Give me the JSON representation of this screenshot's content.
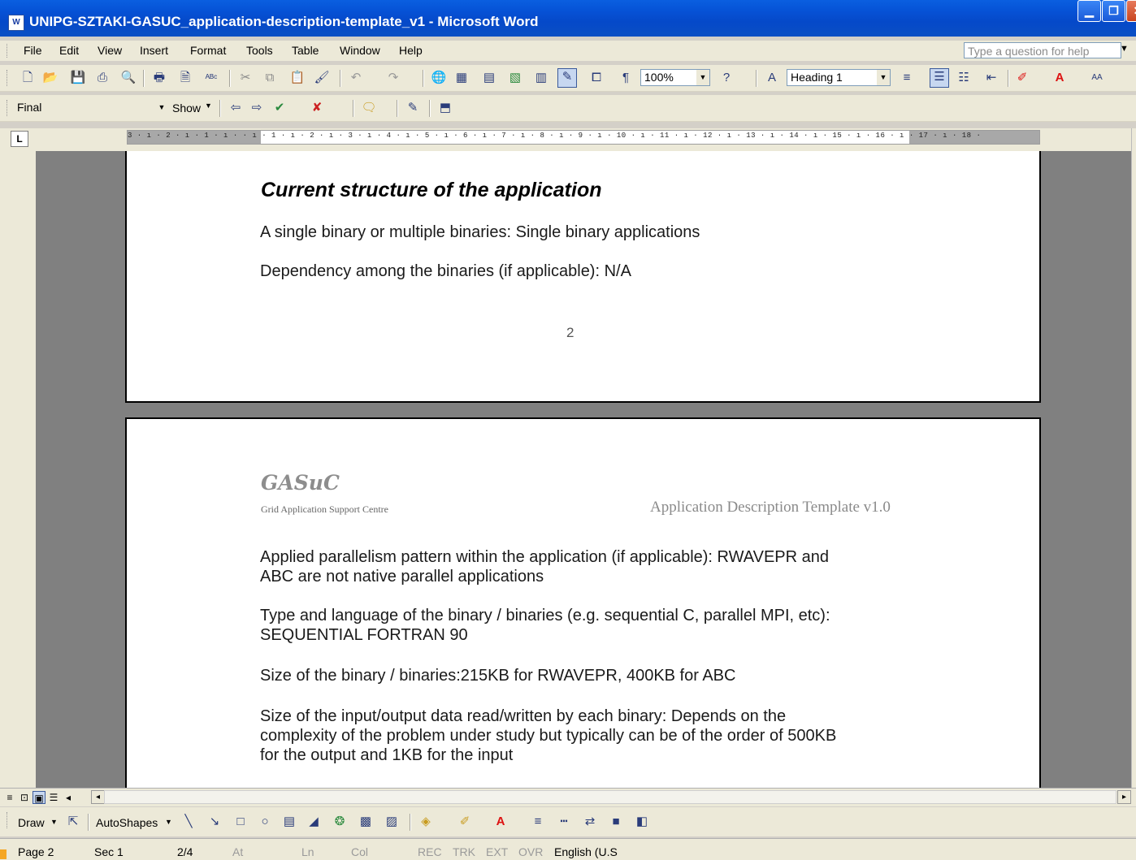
{
  "window": {
    "title": "UNIPG-SZTAKI-GASUC_application-description-template_v1 - Microsoft Word",
    "app_icon": "word-icon"
  },
  "menubar": {
    "items": [
      "File",
      "Edit",
      "View",
      "Insert",
      "Format",
      "Tools",
      "Table",
      "Window",
      "Help"
    ],
    "help_placeholder": "Type a question for help"
  },
  "toolbar_standard": {
    "zoom": "100%",
    "style": "Heading 1"
  },
  "toolbar_reviewing": {
    "display_mode": "Final",
    "show_label": "Show"
  },
  "ruler": {
    "numbers": "3 · ı · 2 · ı · 1 · ı ·  · ı · 1 · ı · 2 · ı · 3 · ı · 4 · ı · 5 · ı · 6 · ı · 7 · ı · 8 · ı · 9 · ı · 10 · ı · 11 · ı · 12 · ı · 13 · ı · 14 · ı · 15 · ı · 16 · ı · 17 · ı · 18 ·"
  },
  "page1": {
    "heading": "Current structure of the application",
    "line1": "A single binary or multiple binaries: Single binary applications",
    "line2": "Dependency among the binaries (if applicable): N/A",
    "page_number": "2"
  },
  "page2": {
    "header_logo": "GASuC",
    "header_sub": "Grid Application Support Centre",
    "header_right": "Application Description Template v1.0",
    "p1a": "Applied parallelism pattern within the application (if applicable): RWAVEPR and",
    "p1b": "ABC are not native parallel applications",
    "p2a": "Type and language of the binary / binaries (e.g. sequential C, parallel MPI, etc):",
    "p2b": "SEQUENTIAL FORTRAN 90",
    "p3": "Size of the binary / binaries:215KB for RWAVEPR, 400KB for ABC",
    "p4a": "Size of the input/output data read/written by each binary: Depends on the",
    "p4b": "complexity of the problem under study but typically can be of the order of 500KB",
    "p4c": "for the output and 1KB for the input"
  },
  "drawbar": {
    "draw_label": "Draw",
    "autoshapes_label": "AutoShapes"
  },
  "statusbar": {
    "page": "Page 2",
    "sec": "Sec 1",
    "pages": "2/4",
    "at": "At",
    "ln": "Ln",
    "col": "Col",
    "rec": "REC",
    "trk": "TRK",
    "ext": "EXT",
    "ovr": "OVR",
    "language": "English (U.S"
  }
}
